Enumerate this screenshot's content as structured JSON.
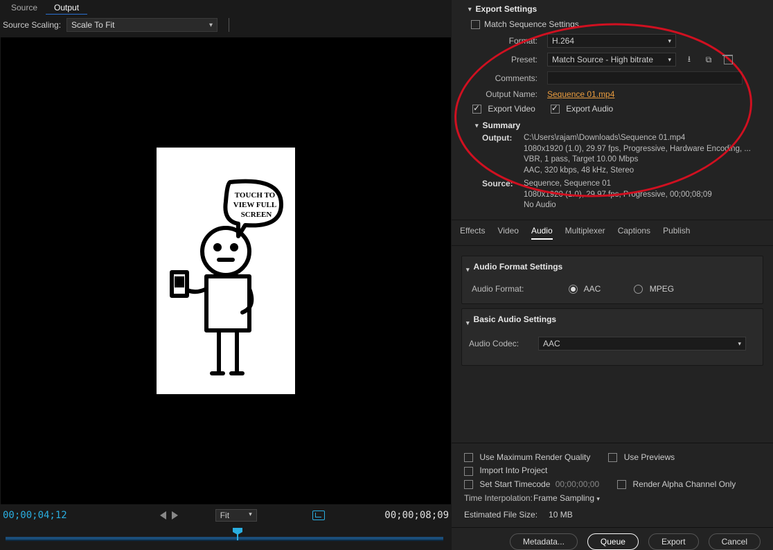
{
  "topTabs": {
    "source": "Source",
    "output": "Output"
  },
  "scaling": {
    "label": "Source Scaling:",
    "value": "Scale To Fit"
  },
  "transport": {
    "posTC": "00;00;04;12",
    "durTC": "00;00;08;09",
    "fitLabel": "Fit"
  },
  "export": {
    "title": "Export Settings",
    "matchSeq": "Match Sequence Settings",
    "formatLabel": "Format:",
    "formatValue": "H.264",
    "presetLabel": "Preset:",
    "presetValue": "Match Source - High bitrate",
    "commentsLabel": "Comments:",
    "outputNameLabel": "Output Name:",
    "outputNameValue": "Sequence 01.mp4",
    "exportVideo": "Export Video",
    "exportAudio": "Export Audio"
  },
  "summary": {
    "title": "Summary",
    "outputLabel": "Output:",
    "outputLines": "C:\\Users\\rajam\\Downloads\\Sequence 01.mp4\n1080x1920 (1.0), 29.97 fps, Progressive, Hardware Encoding, ...\nVBR, 1 pass, Target 10.00 Mbps\nAAC, 320 kbps, 48 kHz, Stereo",
    "sourceLabel": "Source:",
    "sourceLines": "Sequence, Sequence 01\n1080x1920 (1.0), 29.97 fps, Progressive, 00;00;08;09\nNo Audio"
  },
  "tabs": [
    "Effects",
    "Video",
    "Audio",
    "Multiplexer",
    "Captions",
    "Publish"
  ],
  "audioFormat": {
    "title": "Audio Format Settings",
    "label": "Audio Format:",
    "opt1": "AAC",
    "opt2": "MPEG"
  },
  "basicAudio": {
    "title": "Basic Audio Settings",
    "codecLabel": "Audio Codec:",
    "codecValue": "AAC"
  },
  "bottom": {
    "maxRender": "Use Maximum Render Quality",
    "usePreviews": "Use Previews",
    "importProj": "Import Into Project",
    "setStartTC": "Set Start Timecode",
    "startTCVal": "00;00;00;00",
    "renderAlpha": "Render Alpha Channel Only",
    "interpLabel": "Time Interpolation:",
    "interpValue": "Frame Sampling",
    "estLabel": "Estimated File Size:",
    "estValue": "10 MB"
  },
  "buttons": {
    "metadata": "Metadata...",
    "queue": "Queue",
    "export": "Export",
    "cancel": "Cancel"
  }
}
